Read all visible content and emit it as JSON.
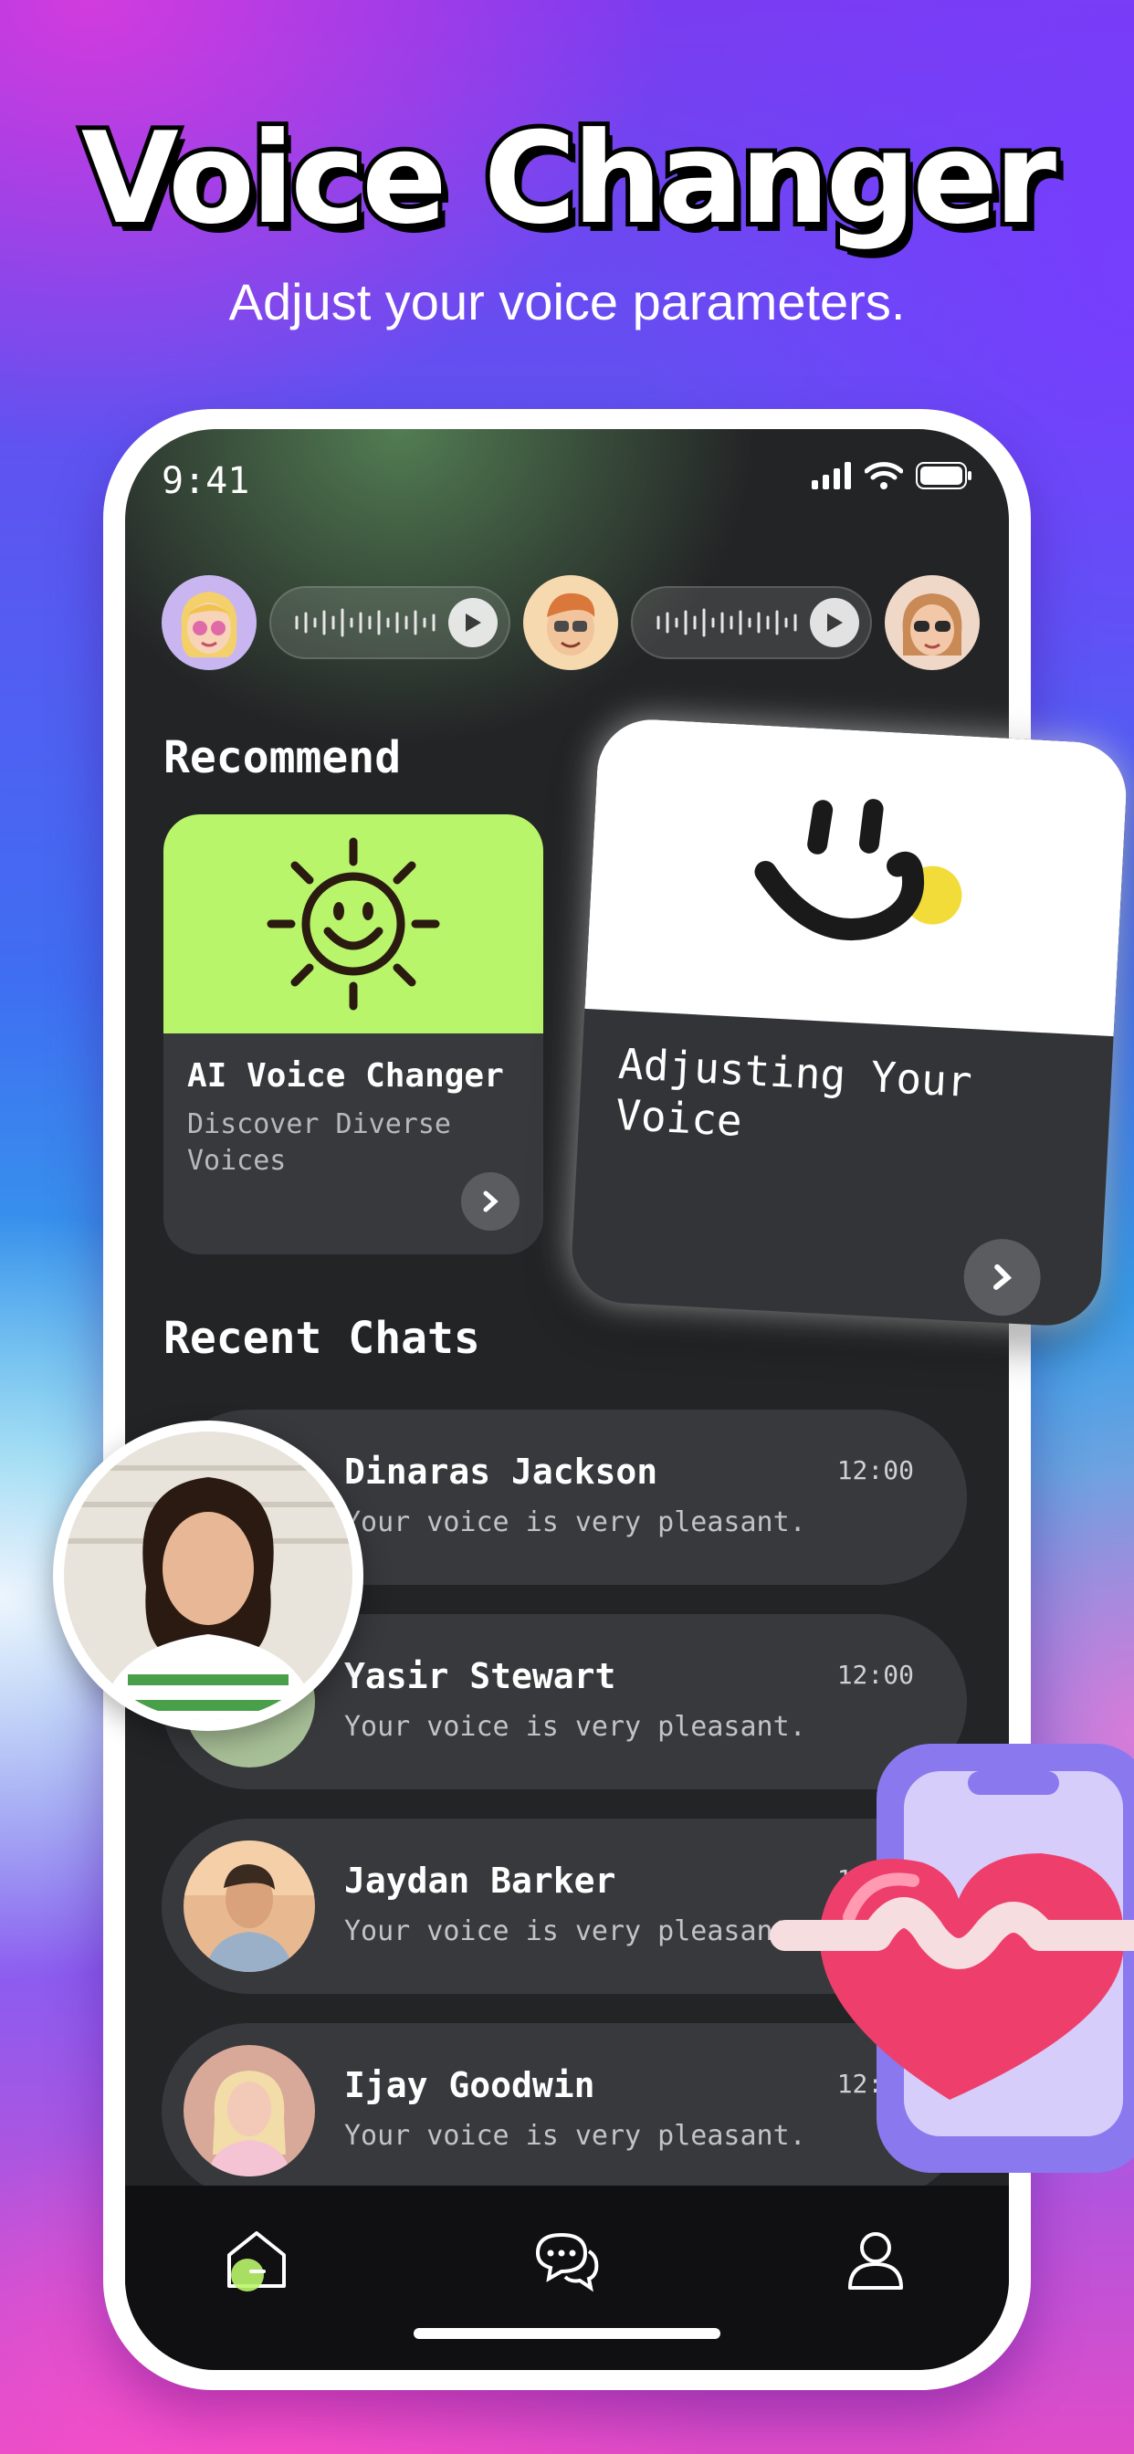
{
  "hero": {
    "title": "Voice Changer",
    "subtitle": "Adjust your voice parameters."
  },
  "status_bar": {
    "time": "9:41",
    "icons": [
      "signal-icon",
      "wifi-icon",
      "battery-icon"
    ]
  },
  "voice_messages": [
    {
      "avatar": "avatar-blonde-memoji"
    },
    {
      "avatar": "avatar-redhair-memoji"
    },
    {
      "avatar": "avatar-sunglasses-memoji"
    }
  ],
  "recommend": {
    "section_title": "Recommend",
    "cards": [
      {
        "title": "AI Voice Changer",
        "description": "Discover Diverse Voices",
        "icon": "sun-smiley-icon",
        "color": "#b9f56a"
      },
      {
        "title": "Adjusting Your Voice",
        "icon": "smile-face-icon"
      }
    ]
  },
  "recent_chats": {
    "section_title": "Recent Chats",
    "items": [
      {
        "name": "Dinaras Jackson",
        "message": "Your voice is very pleasant.",
        "time": "12:00"
      },
      {
        "name": "Yasir Stewart",
        "message": "Your voice is very pleasant.",
        "time": "12:00"
      },
      {
        "name": "Jaydan Barker",
        "message": "Your voice is very pleasant.",
        "time": "12:00"
      },
      {
        "name": "Ijay Goodwin",
        "message": "Your voice is very pleasant.",
        "time": "12:00"
      }
    ]
  },
  "bottom_nav": {
    "items": [
      "home-icon",
      "chat-bubbles-icon",
      "profile-icon"
    ],
    "active_color": "#b9f56a"
  },
  "colors": {
    "screen_bg": "#232426",
    "card_bg": "#38393c",
    "accent": "#b9f56a"
  }
}
